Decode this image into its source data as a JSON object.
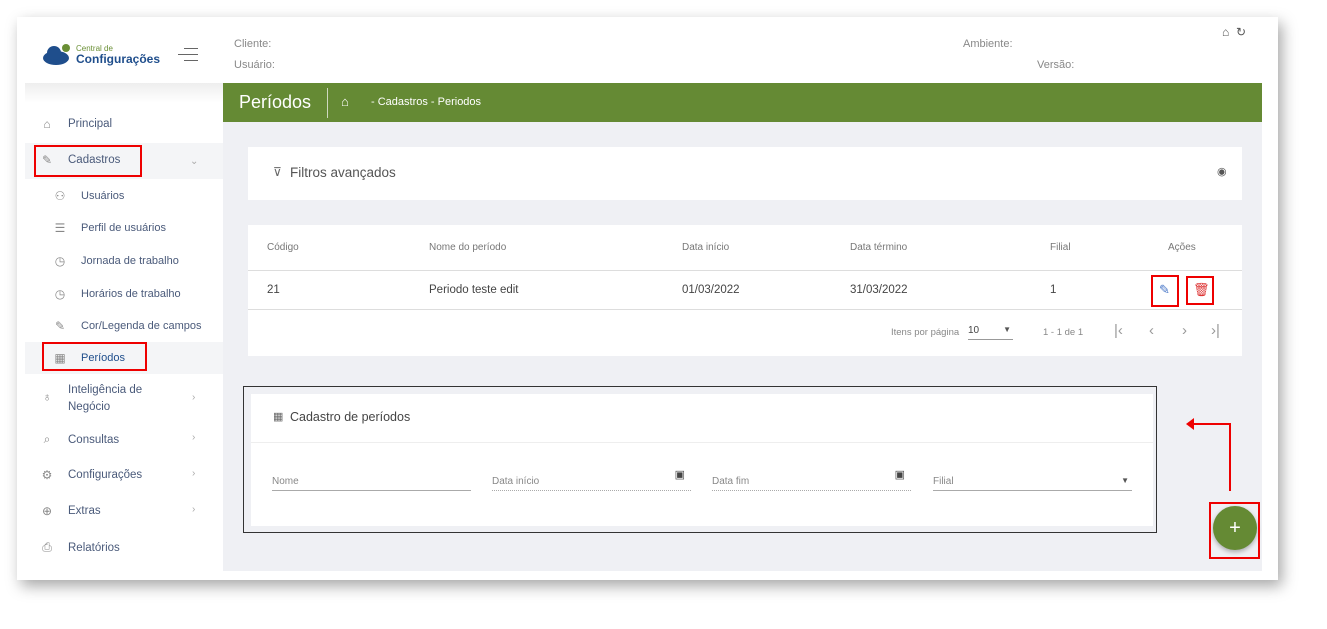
{
  "logo": {
    "line1": "Central de",
    "line2": "Configurações"
  },
  "header": {
    "cliente": "Cliente:",
    "usuario": "Usuário:",
    "ambiente": "Ambiente:",
    "versao": "Versão:"
  },
  "sidebar": {
    "items": [
      {
        "label": "Principal"
      },
      {
        "label": "Cadastros"
      },
      {
        "label": "Usuários"
      },
      {
        "label": "Perfil de usuários"
      },
      {
        "label": "Jornada de trabalho"
      },
      {
        "label": "Horários de trabalho"
      },
      {
        "label": "Cor/Legenda de campos"
      },
      {
        "label": "Períodos"
      },
      {
        "label": "Inteligência de"
      },
      {
        "label": "Negócio"
      },
      {
        "label": "Consultas"
      },
      {
        "label": "Configurações"
      },
      {
        "label": "Extras"
      },
      {
        "label": "Relatórios"
      }
    ]
  },
  "page": {
    "title": "Períodos",
    "breadcrumb": "- Cadastros - Periodos"
  },
  "filters": {
    "title": "Filtros avançados"
  },
  "table": {
    "headers": [
      "Código",
      "Nome do período",
      "Data início",
      "Data término",
      "Filial",
      "Ações"
    ],
    "rows": [
      [
        "21",
        "Periodo teste edit",
        "01/03/2022",
        "31/03/2022",
        "1"
      ]
    ]
  },
  "pagination": {
    "items_label": "Itens por página",
    "page_size": "10",
    "range": "1 - 1 de 1"
  },
  "form": {
    "title": "Cadastro de períodos",
    "nome": "Nome",
    "data_inicio": "Data início",
    "data_fim": "Data fim",
    "filial": "Filial"
  },
  "fab": {
    "label": "+"
  }
}
